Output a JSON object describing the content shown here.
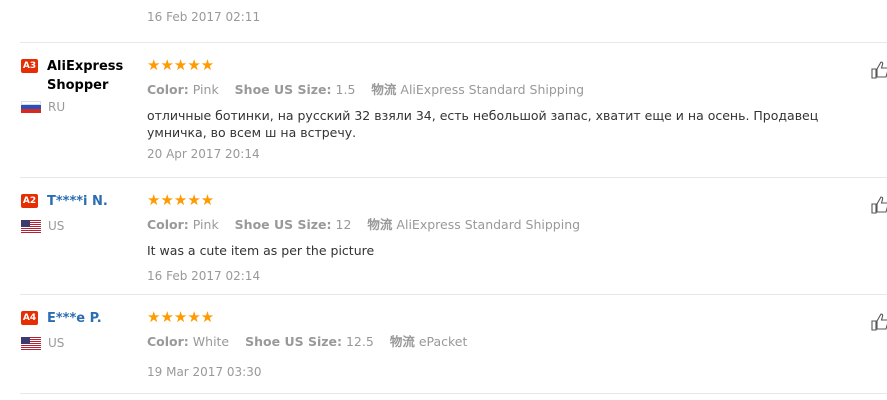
{
  "top_date": "16 Feb 2017 02:11",
  "labels": {
    "color": "Color:",
    "size": "Shoe US Size:",
    "shipping": "物流"
  },
  "reviews": [
    {
      "level": "A3",
      "buyer": "AliExpress Shopper",
      "country": "RU",
      "color": "Pink",
      "size": "1.5",
      "shipping": "AliExpress Standard Shipping",
      "text": "отличные ботинки, на русский 32 взяли 34, есть небольшой запас, хватит еще и на осень. Продавец умничка, во всем ш на встречу.",
      "date": "20 Apr 2017 20:14",
      "stars": "★★★★★"
    },
    {
      "level": "A2",
      "buyer": "T****i N.",
      "country": "US",
      "color": "Pink",
      "size": "12",
      "shipping": "AliExpress Standard Shipping",
      "text": "It was a cute item as per the picture",
      "date": "16 Feb 2017 02:14",
      "stars": "★★★★★"
    },
    {
      "level": "A4",
      "buyer": "E***e P.",
      "country": "US",
      "color": "White",
      "size": "12.5",
      "shipping": "ePacket",
      "text": "",
      "date": "19 Mar 2017 03:30",
      "stars": "★★★★★"
    }
  ],
  "colors": {
    "badge": "#e62e04",
    "star": "#ff9a00",
    "link": "#2a6db3"
  },
  "icons": [
    "thumbs-up-icon",
    "flag-ru-icon",
    "flag-us-icon"
  ]
}
